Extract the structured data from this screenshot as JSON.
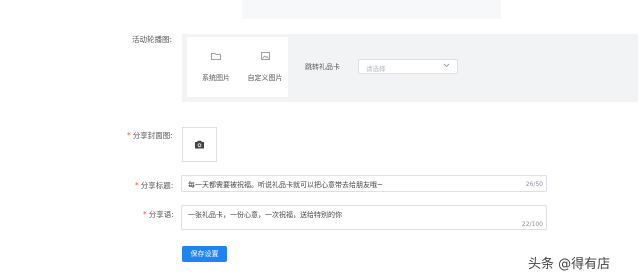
{
  "carousel": {
    "label": "活动轮播图:",
    "options": [
      {
        "label": "系统图片",
        "icon": "folder-icon"
      },
      {
        "label": "自定义图片",
        "icon": "image-icon"
      }
    ],
    "link_label": "跳转礼品卡",
    "select_placeholder": "请选择"
  },
  "cover": {
    "label": "分享封面图:",
    "icon": "camera-icon"
  },
  "share_title": {
    "label": "分享标题:",
    "value": "每一天都需要被祝福。听说礼品卡就可以把心意带去给朋友哦~",
    "count": "26/50"
  },
  "share_text": {
    "label": "分享语:",
    "value": "一张礼品卡，一份心意，一次祝福，送给特别的你",
    "count": "22/100"
  },
  "save_label": "保存设置",
  "watermark": "头条 @得有店",
  "colors": {
    "primary": "#1f83f2",
    "required": "#f5533d",
    "panel": "#f2f3f5",
    "border": "#dcdfe6"
  }
}
